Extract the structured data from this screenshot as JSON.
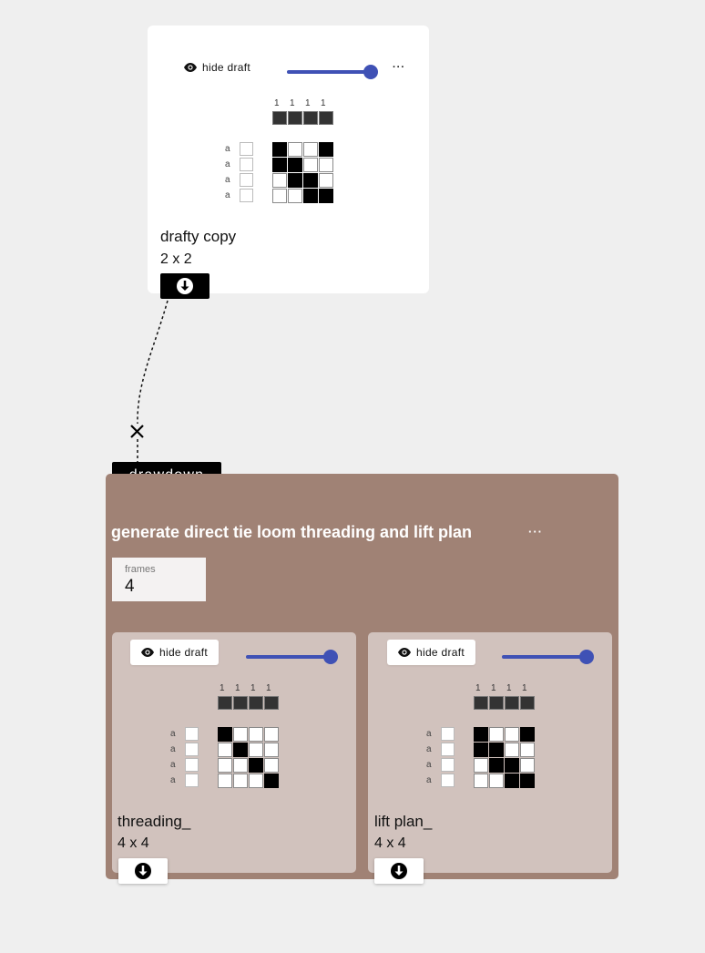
{
  "top_draft": {
    "toggle_label": "hide draft",
    "more_label": "···",
    "name": "drafty copy",
    "dims": "2 x 2",
    "warp_numbers": [
      "1",
      "1",
      "1",
      "1"
    ],
    "row_letters": [
      "a",
      "a",
      "a",
      "a"
    ],
    "grid": [
      [
        1,
        0,
        0,
        1
      ],
      [
        1,
        1,
        0,
        0
      ],
      [
        0,
        1,
        1,
        0
      ],
      [
        0,
        0,
        1,
        1
      ]
    ],
    "slider_value": 1.0,
    "download_icon": "download-icon"
  },
  "connection": {
    "remove_icon": "close-icon",
    "inlet_label": "drawdown"
  },
  "operation": {
    "title": "generate direct tie loom threading and lift plan",
    "more_label": "···",
    "param_label": "frames",
    "param_value": "4",
    "panel_color": "#a08275",
    "outputs": [
      {
        "toggle_label": "hide draft",
        "name": "threading_",
        "dims": "4 x 4",
        "warp_numbers": [
          "1",
          "1",
          "1",
          "1"
        ],
        "row_letters": [
          "a",
          "a",
          "a",
          "a"
        ],
        "grid": [
          [
            1,
            0,
            0,
            0
          ],
          [
            0,
            1,
            0,
            0
          ],
          [
            0,
            0,
            1,
            0
          ],
          [
            0,
            0,
            0,
            1
          ]
        ],
        "slider_value": 1.0
      },
      {
        "toggle_label": "hide draft",
        "name": "lift plan_",
        "dims": "4 x 4",
        "warp_numbers": [
          "1",
          "1",
          "1",
          "1"
        ],
        "row_letters": [
          "a",
          "a",
          "a",
          "a"
        ],
        "grid": [
          [
            1,
            0,
            0,
            1
          ],
          [
            1,
            1,
            0,
            0
          ],
          [
            0,
            1,
            1,
            0
          ],
          [
            0,
            0,
            1,
            1
          ]
        ],
        "slider_value": 1.0
      }
    ]
  },
  "colors": {
    "accent": "#3f51b5",
    "background": "#efefef",
    "subdraft_bg": "#d1c2bd"
  }
}
